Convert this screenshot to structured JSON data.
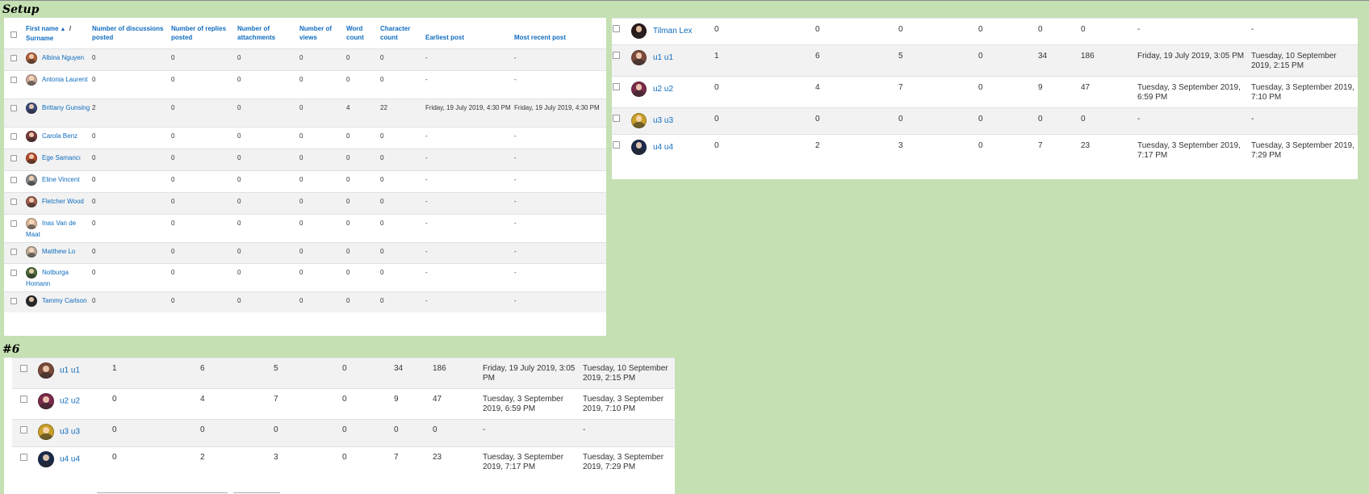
{
  "labels": {
    "setup": "Setup",
    "six": "#6"
  },
  "setup_table": {
    "headers": {
      "name": "First name",
      "sep": "/",
      "surname": "Surname",
      "discussions": "Number of discussions posted",
      "replies": "Number of replies posted",
      "attachments": "Number of attachments",
      "views": "Number of views",
      "words": "Word count",
      "chars": "Character count",
      "earliest": "Earliest post",
      "recent": "Most recent post"
    },
    "rows": [
      {
        "name": "Albina Nguyen",
        "d": "0",
        "r": "0",
        "a": "0",
        "v": "0",
        "w": "0",
        "c": "0",
        "e": "-",
        "m": "-",
        "color": "#b0603a"
      },
      {
        "name": "Antonia Laurent",
        "d": "0",
        "r": "0",
        "a": "0",
        "v": "0",
        "w": "0",
        "c": "0",
        "e": "-",
        "m": "-",
        "color": "#c9a99a"
      },
      {
        "name": "Brittany Gunsing",
        "d": "2",
        "r": "0",
        "a": "0",
        "v": "0",
        "w": "4",
        "c": "22",
        "e": "Friday, 19 July 2019, 4:30 PM",
        "m": "Friday, 19 July 2019, 4:30 PM",
        "color": "#3b4a7a"
      },
      {
        "name": "Carola Benz",
        "d": "0",
        "r": "0",
        "a": "0",
        "v": "0",
        "w": "0",
        "c": "0",
        "e": "-",
        "m": "-",
        "color": "#7a3a3a"
      },
      {
        "name": "Ege Samancı",
        "d": "0",
        "r": "0",
        "a": "0",
        "v": "0",
        "w": "0",
        "c": "0",
        "e": "-",
        "m": "-",
        "color": "#b24a2a"
      },
      {
        "name": "Eline Vincent",
        "d": "0",
        "r": "0",
        "a": "0",
        "v": "0",
        "w": "0",
        "c": "0",
        "e": "-",
        "m": "-",
        "color": "#8a8a8a"
      },
      {
        "name": "Fletcher Wood",
        "d": "0",
        "r": "0",
        "a": "0",
        "v": "0",
        "w": "0",
        "c": "0",
        "e": "-",
        "m": "-",
        "color": "#9a5a4a"
      },
      {
        "name": "Inas Van de Maat",
        "d": "0",
        "r": "0",
        "a": "0",
        "v": "0",
        "w": "0",
        "c": "0",
        "e": "-",
        "m": "-",
        "color": "#d8b89a"
      },
      {
        "name": "Matthew Lo",
        "d": "0",
        "r": "0",
        "a": "0",
        "v": "0",
        "w": "0",
        "c": "0",
        "e": "-",
        "m": "-",
        "color": "#b8a898"
      },
      {
        "name": "Notburga Homann",
        "d": "0",
        "r": "0",
        "a": "0",
        "v": "0",
        "w": "0",
        "c": "0",
        "e": "-",
        "m": "-",
        "color": "#4a6a3a"
      },
      {
        "name": "Tammy Carlson",
        "d": "0",
        "r": "0",
        "a": "0",
        "v": "0",
        "w": "0",
        "c": "0",
        "e": "-",
        "m": "-",
        "color": "#2a2a2a"
      }
    ]
  },
  "big_table": {
    "rows": [
      {
        "name": "Tilman Lex",
        "d": "0",
        "r": "0",
        "a": "0",
        "v": "0",
        "w": "0",
        "c": "0",
        "e": "-",
        "m": "-",
        "color": "#2a1a1a"
      },
      {
        "name": "u1 u1",
        "d": "1",
        "r": "6",
        "a": "5",
        "v": "0",
        "w": "34",
        "c": "186",
        "e": "Friday, 19 July 2019, 3:05 PM",
        "m": "Tuesday, 10 September 2019, 2:15 PM",
        "color": "#7a4a3a"
      },
      {
        "name": "u2 u2",
        "d": "0",
        "r": "4",
        "a": "7",
        "v": "0",
        "w": "9",
        "c": "47",
        "e": "Tuesday, 3 September 2019, 6:59 PM",
        "m": "Tuesday, 3 September 2019, 7:10 PM",
        "color": "#7a2a4a"
      },
      {
        "name": "u3 u3",
        "d": "0",
        "r": "0",
        "a": "0",
        "v": "0",
        "w": "0",
        "c": "0",
        "e": "-",
        "m": "-",
        "color": "#c8a02a"
      },
      {
        "name": "u4 u4",
        "d": "0",
        "r": "2",
        "a": "3",
        "v": "0",
        "w": "7",
        "c": "23",
        "e": "Tuesday, 3 September 2019, 7:17 PM",
        "m": "Tuesday, 3 September 2019, 7:29 PM",
        "color": "#1a2a4a"
      }
    ]
  },
  "six_table": {
    "rows": [
      {
        "name": "u1 u1",
        "d": "1",
        "r": "6",
        "a": "5",
        "v": "0",
        "w": "34",
        "c": "186",
        "e": "Friday, 19 July 2019, 3:05 PM",
        "m": "Tuesday, 10 September 2019, 2:15 PM",
        "color": "#7a4a3a"
      },
      {
        "name": "u2 u2",
        "d": "0",
        "r": "4",
        "a": "7",
        "v": "0",
        "w": "9",
        "c": "47",
        "e": "Tuesday, 3 September 2019, 6:59 PM",
        "m": "Tuesday, 3 September 2019, 7:10 PM",
        "color": "#7a2a4a"
      },
      {
        "name": "u3 u3",
        "d": "0",
        "r": "0",
        "a": "0",
        "v": "0",
        "w": "0",
        "c": "0",
        "e": "-",
        "m": "-",
        "color": "#c8a02a"
      },
      {
        "name": "u4 u4",
        "d": "0",
        "r": "2",
        "a": "3",
        "v": "0",
        "w": "7",
        "c": "23",
        "e": "Tuesday, 3 September 2019, 7:17 PM",
        "m": "Tuesday, 3 September 2019, 7:29 PM",
        "color": "#1a2a4a"
      }
    ]
  }
}
